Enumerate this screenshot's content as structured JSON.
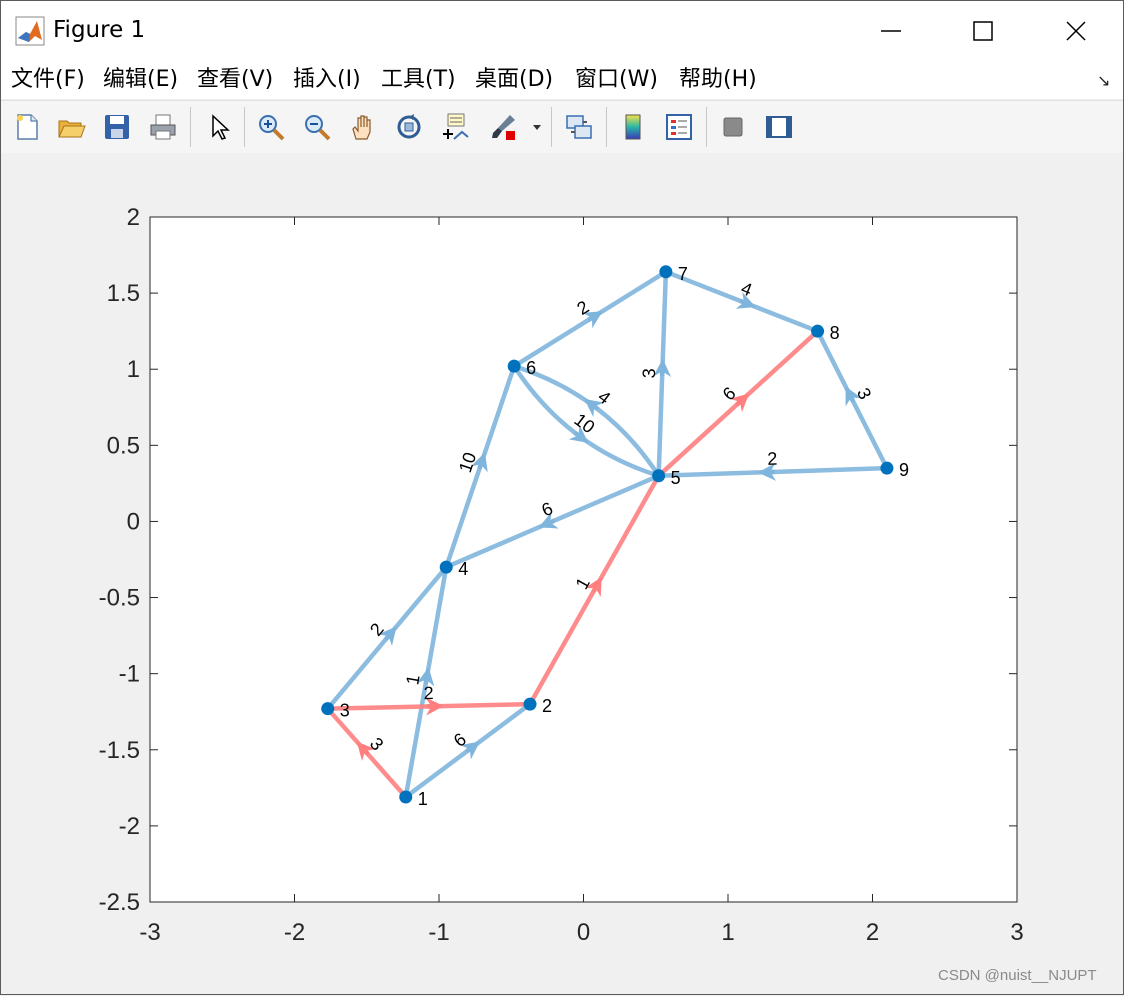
{
  "window": {
    "title": "Figure 1"
  },
  "menu": {
    "items": [
      "文件(F)",
      "编辑(E)",
      "查看(V)",
      "插入(I)",
      "工具(T)",
      "桌面(D)",
      "窗口(W)",
      "帮助(H)"
    ]
  },
  "toolbar": {
    "buttons": [
      "new-figure-icon",
      "open-file-icon",
      "save-icon",
      "print-icon",
      "pointer-icon",
      "zoom-in-icon",
      "zoom-out-icon",
      "pan-hand-icon",
      "rotate-3d-icon",
      "data-cursor-icon",
      "brush-icon",
      "brush-dropdown-icon",
      "link-plot-icon",
      "colorbar-icon",
      "legend-icon",
      "hide-plot-tools-icon",
      "show-plot-tools-icon"
    ]
  },
  "chart_data": {
    "type": "directed-graph",
    "xlim": [
      -3,
      3
    ],
    "ylim": [
      -2.5,
      2
    ],
    "xticks": [
      -3,
      -2,
      -1,
      0,
      1,
      2,
      3
    ],
    "yticks": [
      -2.5,
      -2,
      -1.5,
      -1,
      -0.5,
      0,
      0.5,
      1,
      1.5,
      2
    ],
    "colors": {
      "edge": "#7fb5dc",
      "highlight": "#ff7f7f",
      "node": "#0072bd"
    },
    "nodes": [
      {
        "id": "1",
        "x": -1.23,
        "y": -1.81
      },
      {
        "id": "2",
        "x": -0.37,
        "y": -1.2
      },
      {
        "id": "3",
        "x": -1.77,
        "y": -1.23
      },
      {
        "id": "4",
        "x": -0.95,
        "y": -0.3
      },
      {
        "id": "5",
        "x": 0.52,
        "y": 0.3
      },
      {
        "id": "6",
        "x": -0.48,
        "y": 1.02
      },
      {
        "id": "7",
        "x": 0.57,
        "y": 1.64
      },
      {
        "id": "8",
        "x": 1.62,
        "y": 1.25
      },
      {
        "id": "9",
        "x": 2.1,
        "y": 0.35
      }
    ],
    "edges": [
      {
        "from": "1",
        "to": "2",
        "weight": "6",
        "highlight": false
      },
      {
        "from": "1",
        "to": "3",
        "weight": "3",
        "highlight": true
      },
      {
        "from": "1",
        "to": "4",
        "weight": "1",
        "highlight": false
      },
      {
        "from": "3",
        "to": "2",
        "weight": "2",
        "highlight": true
      },
      {
        "from": "3",
        "to": "4",
        "weight": "2",
        "highlight": false
      },
      {
        "from": "2",
        "to": "5",
        "weight": "1",
        "highlight": true
      },
      {
        "from": "4",
        "to": "6",
        "weight": "10",
        "highlight": false
      },
      {
        "from": "5",
        "to": "4",
        "weight": "6",
        "highlight": false
      },
      {
        "from": "6",
        "to": "7",
        "weight": "2",
        "highlight": false
      },
      {
        "from": "6",
        "to": "5",
        "weight": "10",
        "highlight": false,
        "curve": 1
      },
      {
        "from": "5",
        "to": "6",
        "weight": "4",
        "highlight": false,
        "curve": 1
      },
      {
        "from": "5",
        "to": "7",
        "weight": "3",
        "highlight": false
      },
      {
        "from": "7",
        "to": "8",
        "weight": "4",
        "highlight": false
      },
      {
        "from": "5",
        "to": "8",
        "weight": "6",
        "highlight": true
      },
      {
        "from": "9",
        "to": "8",
        "weight": "3",
        "highlight": false
      },
      {
        "from": "9",
        "to": "5",
        "weight": "2",
        "highlight": false
      }
    ]
  },
  "watermark": "CSDN @nuist__NJUPT"
}
